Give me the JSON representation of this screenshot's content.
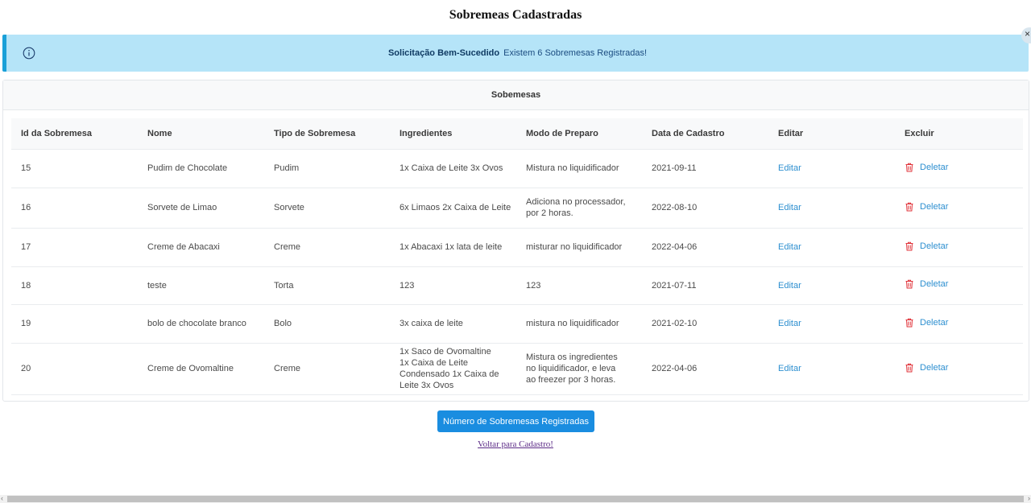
{
  "page": {
    "title": "Sobremeas Cadastradas"
  },
  "alert": {
    "summary": "Solicitação Bem-Sucedido",
    "detail": "Existem 6 Sobremesas Registradas!",
    "close_icon": "×"
  },
  "card": {
    "title": "Sobemesas"
  },
  "table": {
    "columns": [
      "Id da Sobremesa",
      "Nome",
      "Tipo de Sobremesa",
      "Ingredientes",
      "Modo de Preparo",
      "Data de Cadastro",
      "Editar",
      "Excluir"
    ],
    "rows": [
      {
        "id": "15",
        "nome": "Pudim de Chocolate",
        "tipo": "Pudim",
        "ingredientes": "1x Caixa de Leite 3x Ovos",
        "modo": "Mistura no liquidificador",
        "data": "2021-09-11",
        "editar": "Editar",
        "deletar": "Deletar"
      },
      {
        "id": "16",
        "nome": "Sorvete de Limao",
        "tipo": "Sorvete",
        "ingredientes": "6x Limaos 2x Caixa de Leite",
        "modo": "Adiciona no processador, por 2 horas.",
        "data": "2022-08-10",
        "editar": "Editar",
        "deletar": "Deletar"
      },
      {
        "id": "17",
        "nome": "Creme de Abacaxi",
        "tipo": "Creme",
        "ingredientes": "1x Abacaxi 1x lata de leite",
        "modo": "misturar no liquidificador",
        "data": "2022-04-06",
        "editar": "Editar",
        "deletar": "Deletar"
      },
      {
        "id": "18",
        "nome": "teste",
        "tipo": "Torta",
        "ingredientes": "123",
        "modo": "123",
        "data": "2021-07-11",
        "editar": "Editar",
        "deletar": "Deletar"
      },
      {
        "id": "19",
        "nome": "bolo de chocolate branco",
        "tipo": "Bolo",
        "ingredientes": "3x caixa de leite",
        "modo": "mistura no liquidificador",
        "data": "2021-02-10",
        "editar": "Editar",
        "deletar": "Deletar"
      },
      {
        "id": "20",
        "nome": "Creme de Ovomaltine",
        "tipo": "Creme",
        "ingredientes": "1x Saco de Ovomaltine 1x Caixa de Leite Condensado 1x Caixa de Leite 3x Ovos",
        "modo": "Mistura os ingredientes no liquidificador, e leva ao freezer por 3 horas.",
        "data": "2022-04-06",
        "editar": "Editar",
        "deletar": "Deletar"
      }
    ]
  },
  "actions": {
    "count_button": "Número de Sobremesas Registradas",
    "back_link": "Voltar para Cadastro!"
  },
  "colors": {
    "alert_bg": "#b5e4f8",
    "alert_border": "#1aa0d8",
    "primary": "#1a8de0",
    "link": "#2d8fd0",
    "danger": "#e0333a"
  }
}
